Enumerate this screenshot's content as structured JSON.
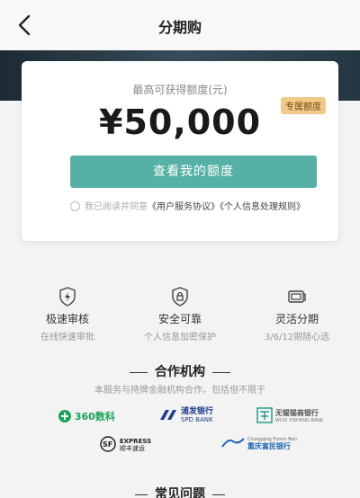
{
  "nav": {
    "title": "分期购"
  },
  "card": {
    "label": "最高可获得额度(元)",
    "amount": "¥50,000",
    "badge": "专属额度",
    "button": "查看我的额度",
    "agree_prefix": "我已阅读并同意",
    "agree_link1": "《用户服务协议》",
    "agree_link2": "《个人信息处理规则》"
  },
  "features": [
    {
      "title": "极速审核",
      "subtitle": "在线快速审批",
      "icon": "lightning-shield-icon"
    },
    {
      "title": "安全可靠",
      "subtitle": "个人信息加密保护",
      "icon": "lock-shield-icon"
    },
    {
      "title": "灵活分期",
      "subtitle": "3/6/12期随心选",
      "icon": "card-icon"
    }
  ],
  "partners": {
    "title": "合作机构",
    "subtitle": "本服务与持牌金融机构合作，包括但不限于",
    "logos": [
      {
        "name": "360数科",
        "color": "#1aa35a"
      },
      {
        "name": "浦发银行",
        "sub": "SPD BANK",
        "color": "#1f3b8a"
      },
      {
        "name": "无锡锡商银行",
        "sub": "WUXI XISHANG BANK",
        "color": "#2a9a8a"
      },
      {
        "name": "EXPRESS",
        "sub": "顺丰速运",
        "color": "#222222"
      },
      {
        "name": "重庆富民银行",
        "sub": "Chongqing Fumin Ban",
        "color": "#1e63b8"
      }
    ]
  },
  "faq": {
    "title": "常见问题"
  },
  "colors": {
    "button": "#56b0a6",
    "badge": "#f1c989",
    "banner": "#2b3c48"
  }
}
